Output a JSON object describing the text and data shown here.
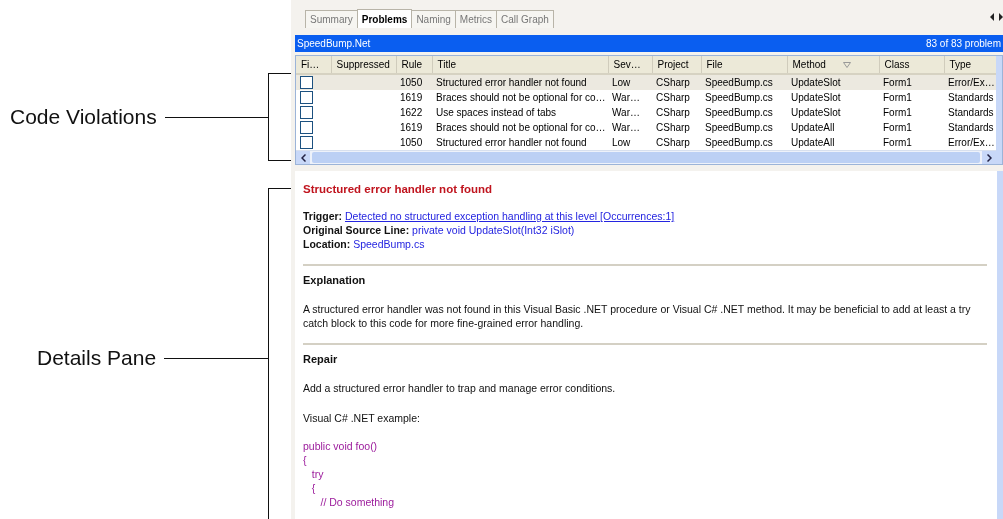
{
  "annotations": [
    {
      "label": "Code Violations"
    },
    {
      "label": "Details Pane"
    }
  ],
  "tabs": [
    {
      "label": "Summary",
      "selected": false
    },
    {
      "label": "Problems",
      "selected": true
    },
    {
      "label": "Naming",
      "selected": false
    },
    {
      "label": "Metrics",
      "selected": false
    },
    {
      "label": "Call Graph",
      "selected": false
    }
  ],
  "header": {
    "title": "SpeedBump.Net",
    "count": "83 of 83 problem"
  },
  "table": {
    "columns": [
      {
        "label": "Fi…",
        "sorted": false
      },
      {
        "label": "Suppressed",
        "sorted": false
      },
      {
        "label": "Rule",
        "sorted": false
      },
      {
        "label": "Title",
        "sorted": false
      },
      {
        "label": "Sev…",
        "sorted": false
      },
      {
        "label": "Project",
        "sorted": false
      },
      {
        "label": "File",
        "sorted": false
      },
      {
        "label": "Method",
        "sorted": true
      },
      {
        "label": "Class",
        "sorted": false
      },
      {
        "label": "Type",
        "sorted": false
      }
    ],
    "rows": [
      {
        "selected": true,
        "checked": false,
        "cells": [
          "",
          "",
          "1050",
          "Structured error handler not found",
          "Low",
          "CSharp",
          "SpeedBump.cs",
          "UpdateSlot",
          "Form1",
          "Error/Ex…"
        ]
      },
      {
        "selected": false,
        "checked": false,
        "cells": [
          "",
          "",
          "1619",
          "Braces should not be optional for co…",
          "War…",
          "CSharp",
          "SpeedBump.cs",
          "UpdateSlot",
          "Form1",
          "Standards"
        ]
      },
      {
        "selected": false,
        "checked": false,
        "cells": [
          "",
          "",
          "1622",
          "Use spaces instead of tabs",
          "War…",
          "CSharp",
          "SpeedBump.cs",
          "UpdateSlot",
          "Form1",
          "Standards"
        ]
      },
      {
        "selected": false,
        "checked": false,
        "cells": [
          "",
          "",
          "1619",
          "Braces should not be optional for co…",
          "War…",
          "CSharp",
          "SpeedBump.cs",
          "UpdateAll",
          "Form1",
          "Standards"
        ]
      },
      {
        "selected": false,
        "checked": false,
        "cells": [
          "",
          "",
          "1050",
          "Structured error handler not found",
          "Low",
          "CSharp",
          "SpeedBump.cs",
          "UpdateAll",
          "Form1",
          "Error/Ex…"
        ]
      }
    ]
  },
  "details": {
    "title": "Structured error handler not found",
    "fields": [
      {
        "label": "Trigger:",
        "value": "Detected no structured exception handling at this level [Occurrences:1]",
        "kind": "link"
      },
      {
        "label": "Original Source Line:",
        "value": "private void UpdateSlot(Int32 iSlot)",
        "kind": "text"
      },
      {
        "label": "Location:",
        "value": "SpeedBump.cs",
        "kind": "text"
      }
    ],
    "sections": [
      {
        "heading": "Explanation",
        "blocks": [
          {
            "kind": "text",
            "lines": [
              "A structured error handler was not found in this Visual Basic .NET procedure or Visual C# .NET method. It may be beneficial to add at least a try catch block to this code for more fine-grained error handling."
            ]
          }
        ]
      },
      {
        "heading": "Repair",
        "blocks": [
          {
            "kind": "text",
            "lines": [
              "Add a structured error handler to trap and manage error conditions."
            ]
          },
          {
            "kind": "text",
            "lines": [
              "Visual C# .NET example:"
            ]
          },
          {
            "kind": "code",
            "lines": [
              "public void foo()",
              "{",
              "   try",
              "   {",
              "      // Do something"
            ]
          }
        ]
      }
    ]
  }
}
